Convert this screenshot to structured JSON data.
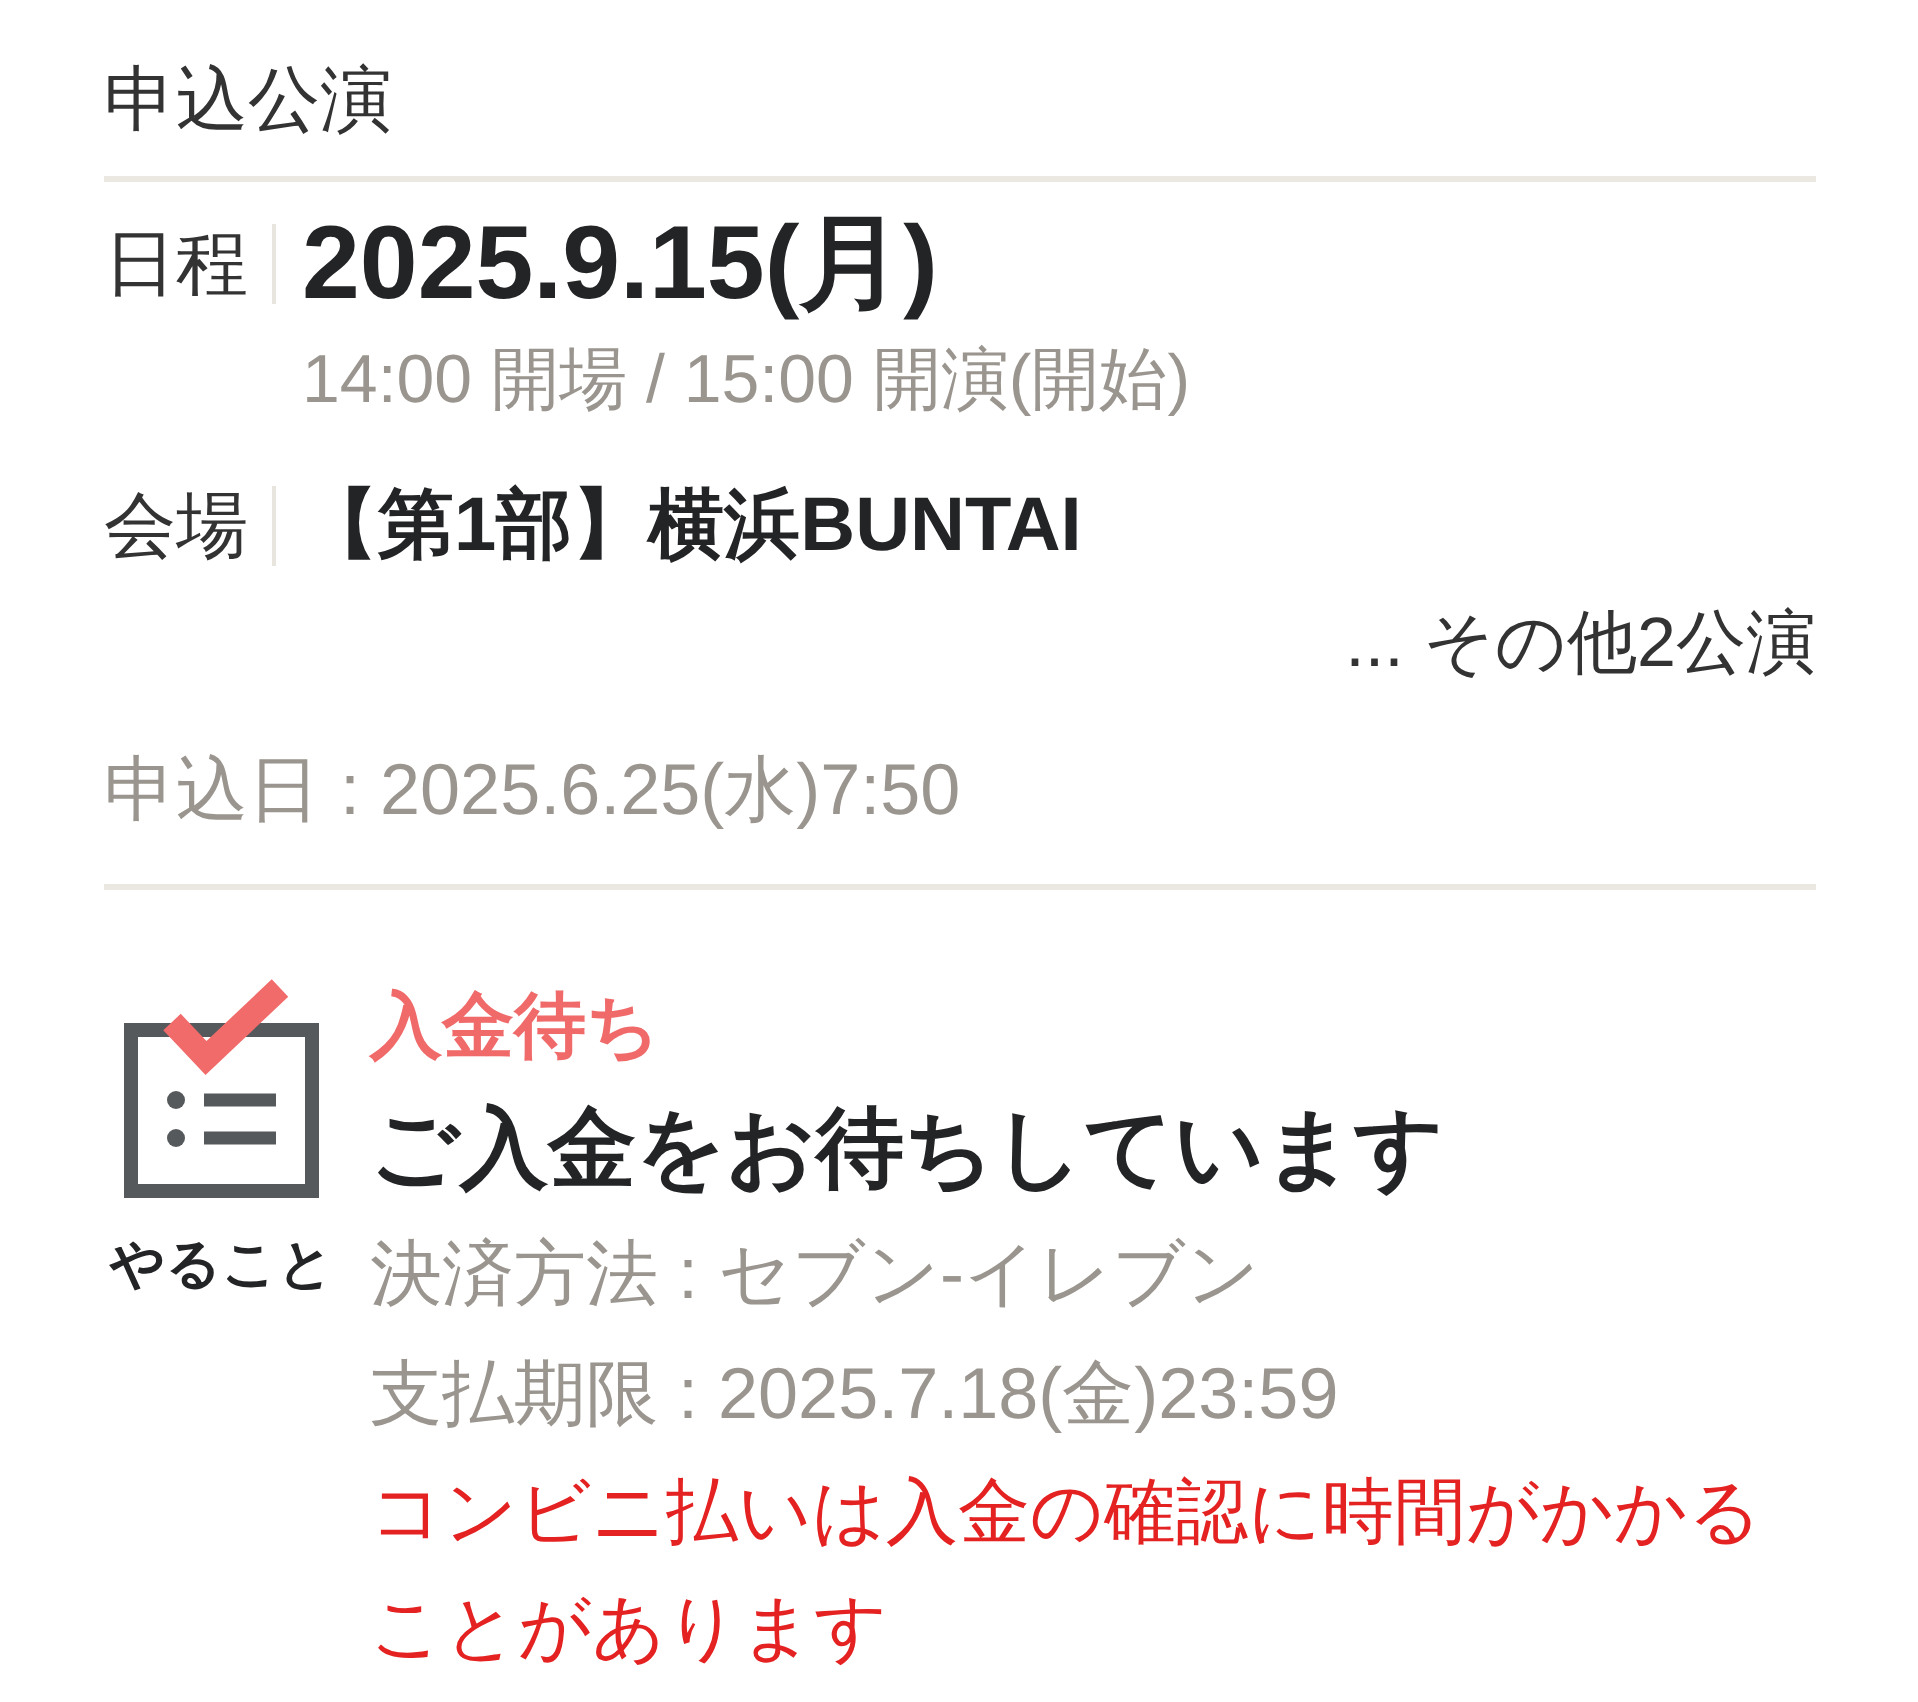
{
  "section_title": "申込公演",
  "details": [
    {
      "kind": "date",
      "label": "日程",
      "value": "2025.9.15(月)",
      "sub": "14:00 開場 / 15:00 開演(開始)"
    },
    {
      "kind": "venue",
      "label": "会場",
      "value": "【第1部】横浜BUNTAI"
    }
  ],
  "more_link": "... その他2公演",
  "applied_at": "申込日 : 2025.6.25(水)7:50",
  "status": {
    "icon_label": "やること",
    "badge": "入金待ち",
    "heading": "ご入金をお待ちしています",
    "lines": [
      "決済方法 : セブン-イレブン",
      "支払期限 : 2025.7.18(金)23:59"
    ],
    "notice": "コンビニ払いは入金の確認に時間がかかることがあります"
  }
}
